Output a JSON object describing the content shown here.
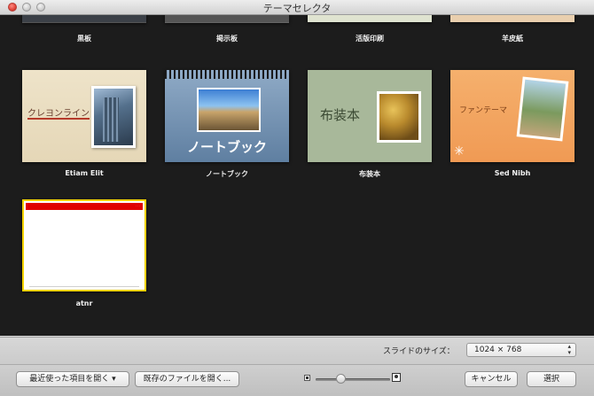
{
  "window": {
    "title": "テーマセレクタ"
  },
  "themes_top": [
    {
      "label": "黒板"
    },
    {
      "label": "掲示板"
    },
    {
      "label": "活版印刷"
    },
    {
      "label": "羊皮紙"
    }
  ],
  "themes_mid": [
    {
      "label": "Etiam Elit",
      "thumb_text": "クレヨンライン"
    },
    {
      "label": "ノートブック",
      "thumb_text": "ノートブック"
    },
    {
      "label": "布装本",
      "thumb_text": "布装本"
    },
    {
      "label": "Sed Nibh",
      "thumb_text": "ファンテーマ"
    }
  ],
  "themes_bottom": [
    {
      "label": "atnr",
      "selected": true
    }
  ],
  "size": {
    "label": "スライドのサイズ：",
    "value": "1024 × 768"
  },
  "footer": {
    "recent_label": "最近使った項目を開く ▾",
    "open_label": "既存のファイルを開く...",
    "cancel_label": "キャンセル",
    "choose_label": "選択",
    "zoom_level": 0.3
  },
  "colors": {
    "selection": "#f3d200",
    "atnr_bar": "#e00000",
    "background": "#1c1c1c"
  }
}
